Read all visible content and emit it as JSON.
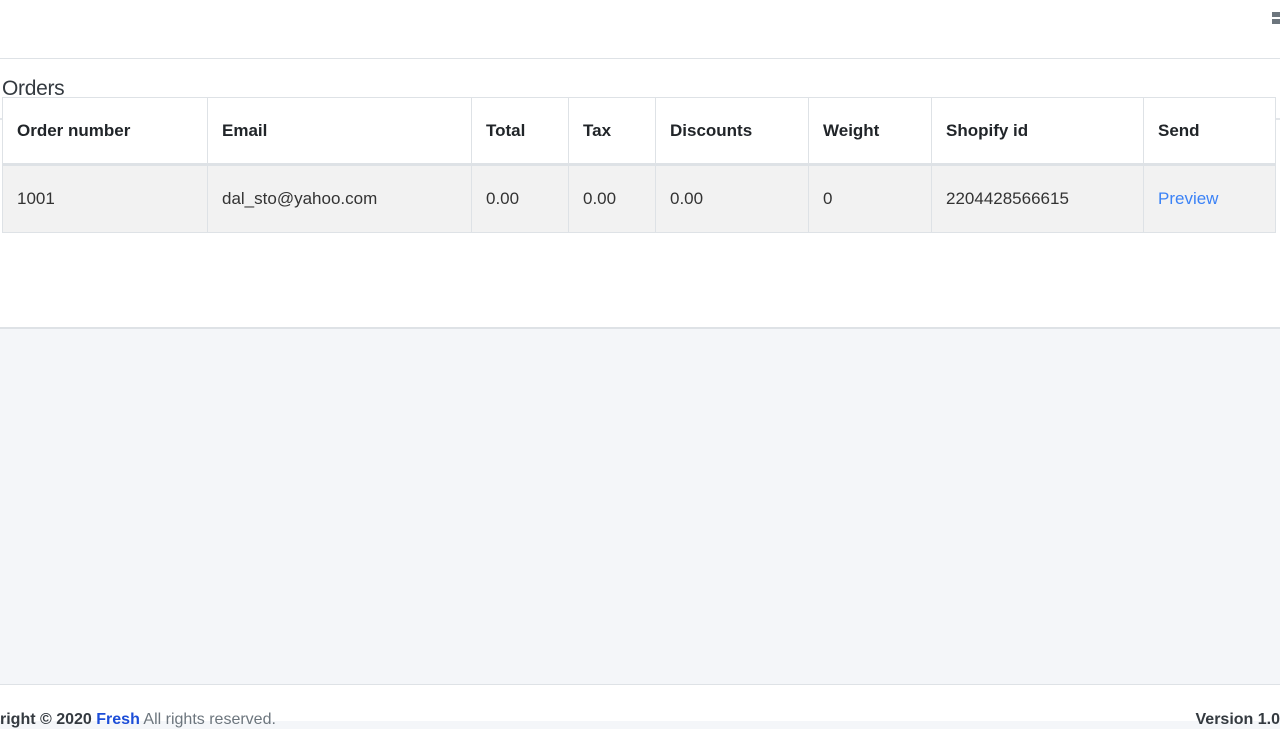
{
  "topbar": {
    "menu_icon": "grid-menu-icon"
  },
  "card": {
    "title": "Orders"
  },
  "table": {
    "headers": [
      "Order number",
      "Email",
      "Total",
      "Tax",
      "Discounts",
      "Weight",
      "Shopify id",
      "Send"
    ],
    "rows": [
      {
        "order_number": "1001",
        "email": "dal_sto@yahoo.com",
        "total": "0.00",
        "tax": "0.00",
        "discounts": "0.00",
        "weight": "0",
        "shopify_id": "2204428566615",
        "send": "Preview"
      }
    ]
  },
  "footer": {
    "copyright": "right © 2020",
    "brand": "Fresh",
    "rights": "All rights reserved.",
    "version": "Version 1.0"
  },
  "colors": {
    "link": "#3b82f6",
    "page_bg": "#f4f6f9",
    "row_bg": "#f2f2f2"
  }
}
